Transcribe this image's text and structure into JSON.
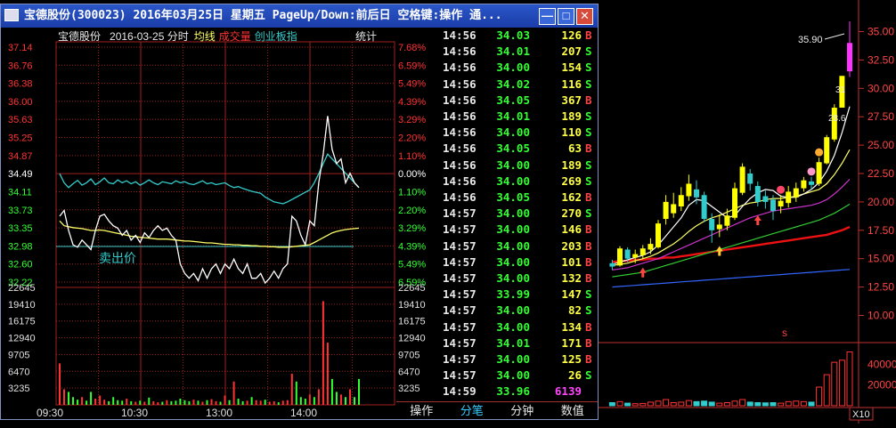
{
  "window": {
    "title": "宝德股份(300023)  2016年03月25日  星期五  PageUp/Down:前后日  空格键:操作  通...",
    "min_label": "—",
    "max_label": "□",
    "close_label": "✕"
  },
  "intraday": {
    "legend_name": "宝德股份",
    "legend_date": "2016-03-25 分时",
    "legend_avg": "均线",
    "legend_vol": "成交量",
    "legend_index": "创业板指",
    "stats_label": "统计",
    "annotation": "卖出价",
    "price_labels": [
      "37.14",
      "36.76",
      "36.38",
      "36.00",
      "35.63",
      "35.25",
      "34.87",
      "34.49",
      "34.11",
      "33.73",
      "33.35",
      "32.98",
      "32.60",
      "32.22"
    ],
    "pct_labels": [
      "7.68%",
      "6.59%",
      "5.49%",
      "4.39%",
      "3.29%",
      "2.20%",
      "1.10%",
      "0.00%",
      "1.10%",
      "2.20%",
      "3.29%",
      "4.39%",
      "5.49%",
      "6.59%"
    ],
    "vol_labels_left": [
      "22645",
      "19410",
      "16175",
      "12940",
      "9705",
      "6470",
      "3235"
    ],
    "vol_labels_right": [
      "22645",
      "19410",
      "16175",
      "12940",
      "9705",
      "6470",
      "3235"
    ],
    "time_labels": [
      "09:30",
      "10:30",
      "13:00",
      "14:00"
    ],
    "colors": {
      "price": "#ffffff",
      "avg": "#ffff66",
      "index": "#33cccc",
      "up": "#ff3333",
      "down": "#33ff33",
      "grid": "#a02020"
    },
    "price_series": [
      33.6,
      33.72,
      33.3,
      33.0,
      32.95,
      33.1,
      33.0,
      32.9,
      33.3,
      33.6,
      33.64,
      33.5,
      33.4,
      33.35,
      33.2,
      33.3,
      33.1,
      33.2,
      33.05,
      33.25,
      33.15,
      33.3,
      33.4,
      33.3,
      33.35,
      33.2,
      33.1,
      32.6,
      32.4,
      32.3,
      32.4,
      32.25,
      32.5,
      32.3,
      32.5,
      32.6,
      32.4,
      32.6,
      32.5,
      32.7,
      32.5,
      32.4,
      32.6,
      32.3,
      32.3,
      32.4,
      32.2,
      32.3,
      32.45,
      32.3,
      32.5,
      32.6,
      33.6,
      33.5,
      33.2,
      33.0,
      33.5,
      33.4,
      34.3,
      34.9,
      35.7,
      35.0,
      34.7,
      34.8,
      34.3,
      34.5,
      34.3,
      34.2
    ],
    "avg_series": [
      33.5,
      33.4,
      33.38,
      33.36,
      33.35,
      33.34,
      33.32,
      33.3,
      33.3,
      33.31,
      33.3,
      33.28,
      33.26,
      33.24,
      33.22,
      33.2,
      33.18,
      33.17,
      33.16,
      33.15,
      33.14,
      33.13,
      33.12,
      33.12,
      33.12,
      33.11,
      33.1,
      33.09,
      33.08,
      33.08,
      33.07,
      33.06,
      33.05,
      33.04,
      33.04,
      33.03,
      33.02,
      33.01,
      33.01,
      33.0,
      33.0,
      32.99,
      32.99,
      32.98,
      32.98,
      32.97,
      32.97,
      32.96,
      32.96,
      32.95,
      32.95,
      32.95,
      32.96,
      32.97,
      32.98,
      32.99,
      33.0,
      33.05,
      33.1,
      33.15,
      33.2,
      33.25,
      33.28,
      33.3,
      33.32,
      33.33,
      33.34,
      33.35
    ],
    "index_series": [
      34.49,
      34.3,
      34.2,
      34.28,
      34.35,
      34.25,
      34.3,
      34.38,
      34.26,
      34.32,
      34.4,
      34.3,
      34.28,
      34.36,
      34.3,
      34.34,
      34.28,
      34.32,
      34.25,
      34.3,
      34.36,
      34.3,
      34.26,
      34.32,
      34.3,
      34.28,
      34.34,
      34.3,
      34.32,
      34.28,
      34.26,
      34.3,
      34.34,
      34.28,
      34.3,
      34.26,
      34.28,
      34.3,
      34.24,
      34.2,
      34.22,
      34.18,
      34.15,
      34.12,
      34.1,
      34.08,
      34.0,
      33.95,
      33.9,
      33.88,
      33.86,
      33.9,
      33.95,
      34.0,
      34.05,
      34.1,
      34.15,
      34.3,
      34.49,
      34.7,
      34.9,
      34.8,
      34.7,
      34.6,
      34.5,
      34.4,
      34.3,
      34.2
    ],
    "volume_series": [
      8000,
      3000,
      2500,
      1500,
      1000,
      1500,
      800,
      2500,
      1200,
      1800,
      1000,
      700,
      1500,
      900,
      800,
      1200,
      700,
      600,
      800,
      600,
      1400,
      700,
      500,
      600,
      900,
      700,
      800,
      1200,
      900,
      700,
      1000,
      800,
      600,
      900,
      1100,
      700,
      600,
      1800,
      900,
      4500,
      1200,
      700,
      800,
      1500,
      900,
      800,
      1000,
      600,
      700,
      500,
      800,
      900,
      6000,
      4500,
      1500,
      1200,
      2000,
      1500,
      3000,
      20000,
      12000,
      5000,
      2500,
      2000,
      1500,
      3000,
      1500,
      5000
    ]
  },
  "ticks": [
    {
      "time": "14:56",
      "price": "34.03",
      "vol": "126",
      "dir": "B"
    },
    {
      "time": "14:56",
      "price": "34.01",
      "vol": "207",
      "dir": "S"
    },
    {
      "time": "14:56",
      "price": "34.00",
      "vol": "154",
      "dir": "S"
    },
    {
      "time": "14:56",
      "price": "34.02",
      "vol": "116",
      "dir": "S"
    },
    {
      "time": "14:56",
      "price": "34.05",
      "vol": "367",
      "dir": "B"
    },
    {
      "time": "14:56",
      "price": "34.01",
      "vol": "189",
      "dir": "S"
    },
    {
      "time": "14:56",
      "price": "34.00",
      "vol": "110",
      "dir": "S"
    },
    {
      "time": "14:56",
      "price": "34.05",
      "vol": "63",
      "dir": "B"
    },
    {
      "time": "14:56",
      "price": "34.00",
      "vol": "189",
      "dir": "S"
    },
    {
      "time": "14:56",
      "price": "34.00",
      "vol": "269",
      "dir": "S"
    },
    {
      "time": "14:56",
      "price": "34.05",
      "vol": "162",
      "dir": "B"
    },
    {
      "time": "14:57",
      "price": "34.00",
      "vol": "270",
      "dir": "S"
    },
    {
      "time": "14:57",
      "price": "34.00",
      "vol": "146",
      "dir": "B"
    },
    {
      "time": "14:57",
      "price": "34.00",
      "vol": "203",
      "dir": "B"
    },
    {
      "time": "14:57",
      "price": "34.00",
      "vol": "101",
      "dir": "B"
    },
    {
      "time": "14:57",
      "price": "34.00",
      "vol": "132",
      "dir": "B"
    },
    {
      "time": "14:57",
      "price": "33.99",
      "vol": "147",
      "dir": "S"
    },
    {
      "time": "14:57",
      "price": "34.00",
      "vol": "82",
      "dir": "S"
    },
    {
      "time": "14:57",
      "price": "34.00",
      "vol": "134",
      "dir": "B"
    },
    {
      "time": "14:57",
      "price": "34.01",
      "vol": "171",
      "dir": "B"
    },
    {
      "time": "14:57",
      "price": "34.00",
      "vol": "125",
      "dir": "B"
    },
    {
      "time": "14:57",
      "price": "34.00",
      "vol": "26",
      "dir": "S"
    },
    {
      "time": "14:59",
      "price": "33.96",
      "vol": "6139",
      "dir": ""
    }
  ],
  "tabs": [
    {
      "label": "操作",
      "active": false
    },
    {
      "label": "分笔",
      "active": true
    },
    {
      "label": "分钟",
      "active": false
    },
    {
      "label": "数值",
      "active": false
    }
  ],
  "kline": {
    "price_labels": [
      "35.00",
      "32.50",
      "30.00",
      "27.50",
      "25.00",
      "22.50",
      "20.00",
      "17.50",
      "15.00",
      "12.50",
      "10.00"
    ],
    "vol_labels": [
      "40000",
      "20000"
    ],
    "peak_label": "35.90",
    "mark_31": "31",
    "mark_28": "28.6",
    "corner_label": "X10",
    "s_marker": "s",
    "colors": {
      "up": "#ffff00",
      "down": "#33cccc",
      "limit": "#ff33ff",
      "ma5": "#ffffff",
      "ma10": "#ffff66",
      "ma20": "#cc33cc",
      "ma30": "#33cc33",
      "ma60": "#ee1111",
      "ma120": "#3366ff"
    },
    "candles": [
      {
        "o": 14.6,
        "c": 14.3,
        "h": 14.9,
        "l": 14.0
      },
      {
        "o": 14.4,
        "c": 15.9,
        "h": 16.1,
        "l": 14.3
      },
      {
        "o": 15.8,
        "c": 15.0,
        "h": 16.0,
        "l": 14.7
      },
      {
        "o": 15.1,
        "c": 15.4,
        "h": 15.8,
        "l": 14.6
      },
      {
        "o": 15.3,
        "c": 15.9,
        "h": 16.2,
        "l": 15.0
      },
      {
        "o": 15.8,
        "c": 16.3,
        "h": 16.8,
        "l": 15.4
      },
      {
        "o": 16.0,
        "c": 18.1,
        "h": 18.4,
        "l": 15.9
      },
      {
        "o": 18.5,
        "c": 20.0,
        "h": 20.6,
        "l": 18.0
      },
      {
        "o": 19.0,
        "c": 19.8,
        "h": 20.8,
        "l": 18.6
      },
      {
        "o": 19.6,
        "c": 20.6,
        "h": 21.3,
        "l": 19.2
      },
      {
        "o": 20.5,
        "c": 21.6,
        "h": 22.4,
        "l": 20.1
      },
      {
        "o": 21.1,
        "c": 20.4,
        "h": 21.9,
        "l": 19.8
      },
      {
        "o": 20.6,
        "c": 18.5,
        "h": 20.9,
        "l": 18.2
      },
      {
        "o": 18.5,
        "c": 17.5,
        "h": 19.0,
        "l": 16.4
      },
      {
        "o": 17.6,
        "c": 18.0,
        "h": 18.9,
        "l": 16.9
      },
      {
        "o": 17.9,
        "c": 18.8,
        "h": 19.4,
        "l": 17.5
      },
      {
        "o": 18.6,
        "c": 21.2,
        "h": 21.7,
        "l": 18.4
      },
      {
        "o": 20.8,
        "c": 23.1,
        "h": 23.4,
        "l": 20.6
      },
      {
        "o": 22.5,
        "c": 21.6,
        "h": 22.9,
        "l": 21.0
      },
      {
        "o": 21.4,
        "c": 20.0,
        "h": 21.8,
        "l": 19.6
      },
      {
        "o": 20.5,
        "c": 20.0,
        "h": 21.0,
        "l": 19.4
      },
      {
        "o": 20.2,
        "c": 19.2,
        "h": 20.6,
        "l": 18.4
      },
      {
        "o": 19.6,
        "c": 20.1,
        "h": 20.6,
        "l": 19.0
      },
      {
        "o": 19.9,
        "c": 20.9,
        "h": 21.4,
        "l": 19.5
      },
      {
        "o": 20.4,
        "c": 21.2,
        "h": 21.7,
        "l": 20.0
      },
      {
        "o": 21.2,
        "c": 21.9,
        "h": 22.2,
        "l": 20.9
      },
      {
        "o": 21.8,
        "c": 21.5,
        "h": 22.2,
        "l": 21.1
      },
      {
        "o": 21.6,
        "c": 23.5,
        "h": 23.9,
        "l": 21.4
      },
      {
        "o": 23.4,
        "c": 25.7,
        "h": 25.9,
        "l": 23.3
      },
      {
        "o": 25.5,
        "c": 28.3,
        "h": 28.6,
        "l": 25.3
      },
      {
        "o": 28.3,
        "c": 31.1,
        "h": 31.1,
        "l": 28.3
      },
      {
        "o": 31.5,
        "c": 34.0,
        "h": 35.9,
        "l": 31.0
      }
    ],
    "volumes": [
      3000,
      4000,
      2500,
      2000,
      2200,
      3500,
      4500,
      6000,
      3000,
      3500,
      5000,
      4000,
      4500,
      3500,
      2500,
      3000,
      4500,
      6000,
      3500,
      3000,
      2800,
      3000,
      2500,
      4000,
      4500,
      4000,
      3500,
      18000,
      30000,
      42000,
      44000,
      52000
    ],
    "ma5": [
      14.5,
      14.7,
      14.9,
      15.1,
      15.3,
      15.6,
      16.2,
      17.0,
      17.8,
      18.6,
      19.7,
      20.2,
      20.1,
      19.6,
      19.1,
      18.6,
      18.8,
      19.6,
      20.3,
      20.8,
      21.1,
      21.0,
      20.5,
      20.4,
      20.4,
      20.7,
      21.1,
      21.7,
      22.7,
      24.1,
      26.1,
      28.4
    ],
    "ma10": [
      14.4,
      14.5,
      14.6,
      14.8,
      15.0,
      15.2,
      15.5,
      15.9,
      16.3,
      16.8,
      17.4,
      17.9,
      18.3,
      18.6,
      18.8,
      19.1,
      19.4,
      19.7,
      19.9,
      20.0,
      20.2,
      20.3,
      20.3,
      20.4,
      20.5,
      20.7,
      20.9,
      21.1,
      21.6,
      22.4,
      23.4,
      24.6
    ],
    "ma20": [
      14.0,
      14.1,
      14.2,
      14.4,
      14.6,
      14.8,
      15.0,
      15.3,
      15.6,
      15.9,
      16.2,
      16.5,
      16.8,
      17.1,
      17.4,
      17.7,
      18.0,
      18.3,
      18.6,
      18.8,
      19.0,
      19.2,
      19.3,
      19.4,
      19.5,
      19.6,
      19.7,
      19.9,
      20.2,
      20.7,
      21.3,
      22.0
    ],
    "ma30": [
      13.4,
      13.5,
      13.6,
      13.7,
      13.8,
      14.0,
      14.2,
      14.4,
      14.6,
      14.8,
      15.0,
      15.2,
      15.4,
      15.6,
      15.8,
      16.0,
      16.2,
      16.4,
      16.6,
      16.8,
      17.0,
      17.2,
      17.4,
      17.6,
      17.8,
      18.0,
      18.2,
      18.4,
      18.7,
      19.0,
      19.4,
      19.8
    ],
    "ma60": [
      14.7,
      14.8,
      14.8,
      14.9,
      14.9,
      15.0,
      15.0,
      15.1,
      15.1,
      15.2,
      15.3,
      15.4,
      15.5,
      15.6,
      15.7,
      15.8,
      15.9,
      16.0,
      16.1,
      16.2,
      16.3,
      16.4,
      16.5,
      16.6,
      16.7,
      16.8,
      16.9,
      17.0,
      17.1,
      17.3,
      17.5,
      17.8
    ],
    "ma120": [
      12.5,
      12.55,
      12.6,
      12.65,
      12.7,
      12.75,
      12.8,
      12.85,
      12.9,
      12.95,
      13.0,
      13.05,
      13.1,
      13.15,
      13.2,
      13.25,
      13.3,
      13.35,
      13.4,
      13.45,
      13.5,
      13.55,
      13.6,
      13.65,
      13.7,
      13.75,
      13.8,
      13.85,
      13.9,
      13.95,
      14.0,
      14.05
    ]
  }
}
